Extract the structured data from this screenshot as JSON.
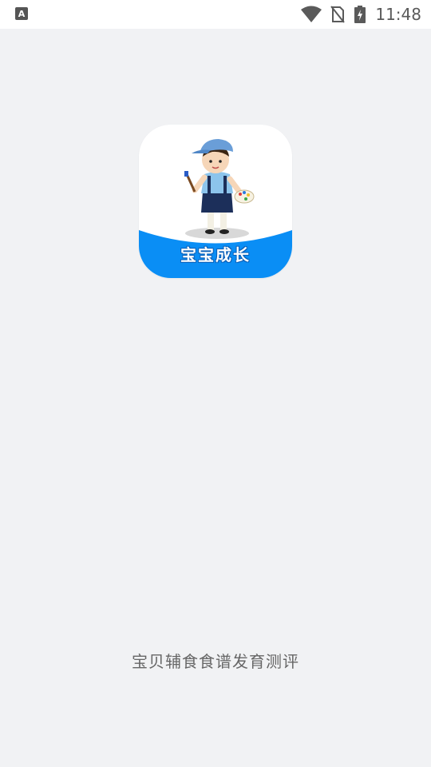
{
  "status_bar": {
    "left_icon": "A",
    "left_icon_name": "accessibility-a-icon",
    "icons": [
      "wifi-icon",
      "no-sim-icon",
      "battery-charging-icon"
    ],
    "time": "11:48"
  },
  "logo": {
    "text": "宝宝成长",
    "brand_color": "#0A8EF5"
  },
  "tagline": "宝贝辅食食谱发育测评",
  "colors": {
    "background": "#F1F2F4",
    "status_bar": "#FFFFFF",
    "tagline": "#666666"
  }
}
